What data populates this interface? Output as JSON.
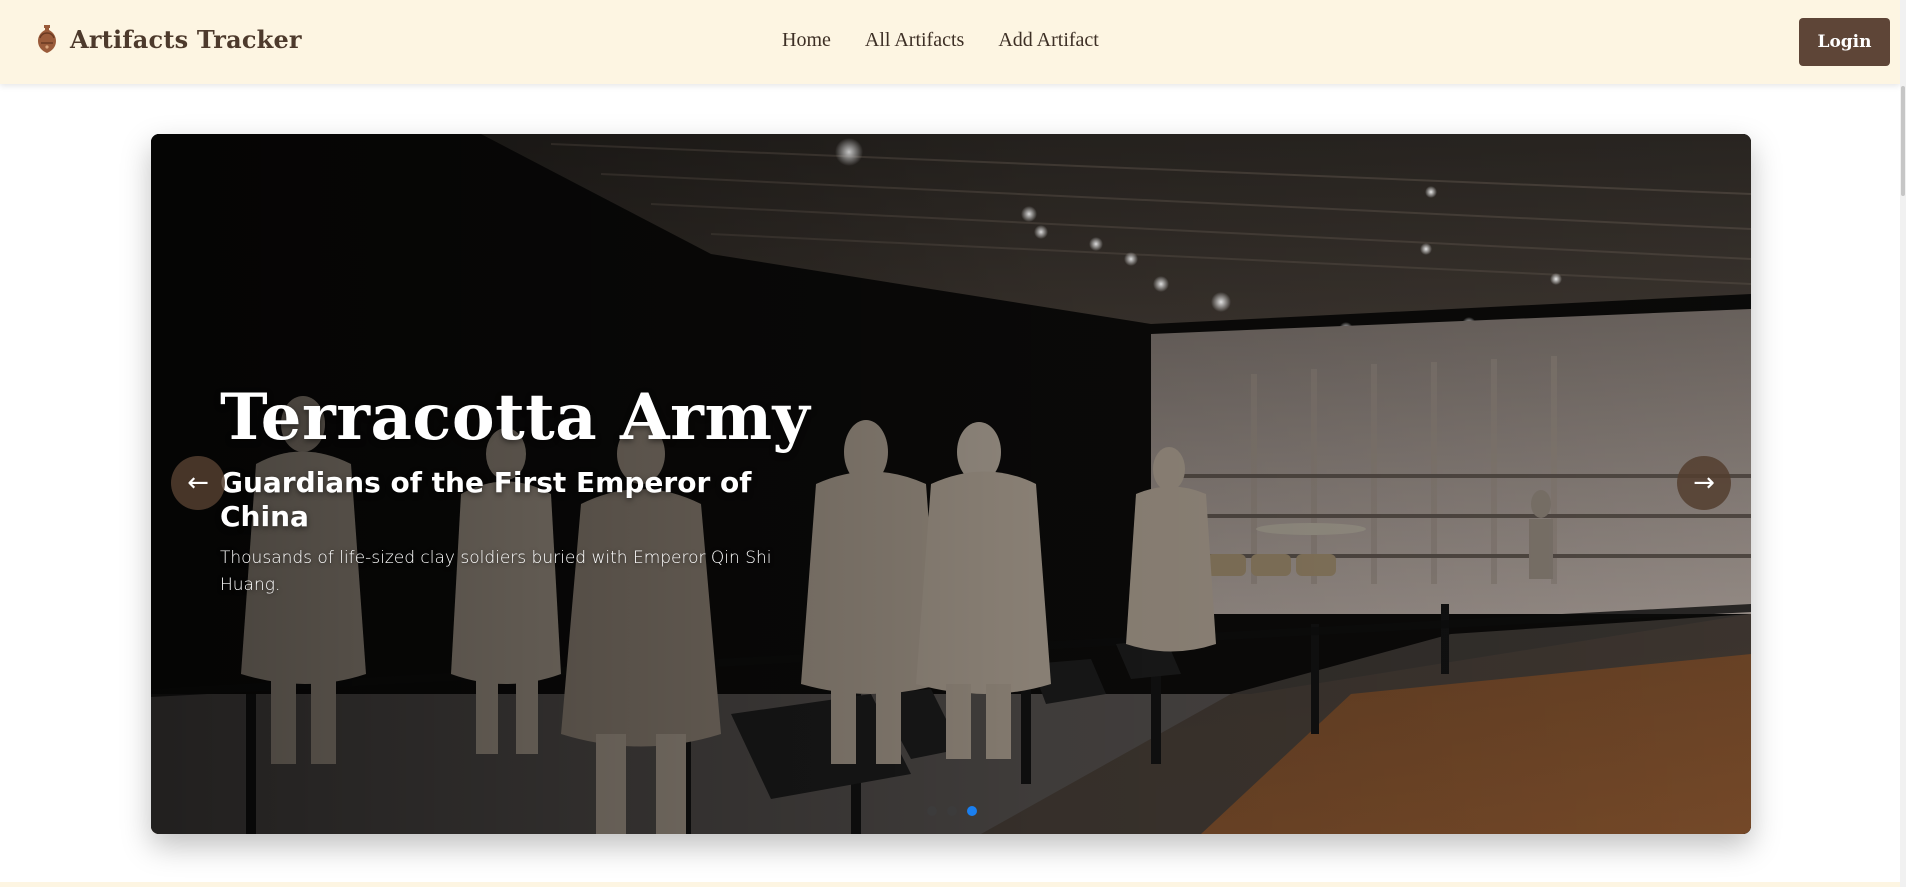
{
  "brand": {
    "name": "Artifacts Tracker",
    "icon": "amphora-icon"
  },
  "nav": {
    "links": [
      {
        "label": "Home"
      },
      {
        "label": "All Artifacts"
      },
      {
        "label": "Add Artifact"
      }
    ],
    "login_label": "Login"
  },
  "carousel": {
    "slide": {
      "title": "Terracotta Army",
      "subtitle": "Guardians of the First Emperor of China",
      "description": "Thousands of life-sized clay soldiers buried with Emperor Qin Shi Huang."
    },
    "prev_icon": "arrow-left-icon",
    "prev_label": "←",
    "next_icon": "arrow-right-icon",
    "next_label": "→",
    "slide_count": 3,
    "active_index": 2
  },
  "colors": {
    "navbar_bg": "#fdf5e2",
    "brand_text": "#4d3a2c",
    "login_bg": "#5e4537",
    "arrow_bg": "#543e2f",
    "dot_active": "#1a7ff0"
  }
}
